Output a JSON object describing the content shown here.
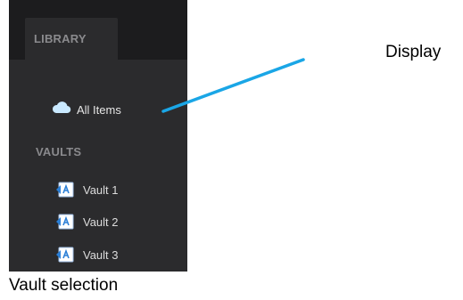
{
  "sidebar": {
    "tab_label": "LIBRARY",
    "all_items_label": "All Items",
    "all_items_icon": "cloud-icon",
    "vaults_heading": "VAULTS",
    "vault_icon": "vault-icon",
    "vaults": [
      {
        "label": "Vault 1"
      },
      {
        "label": "Vault 2"
      },
      {
        "label": "Vault 3"
      }
    ]
  },
  "annotations": {
    "display_label": "Display",
    "caption": "Vault selection",
    "pointer_color": "#1aa6e6"
  },
  "colors": {
    "sidebar_bg": "#2b2b2d",
    "sidebar_top": "#1c1c1e",
    "muted_text": "#8a8a8d",
    "item_text": "#e6e6e6",
    "vault_icon_blue": "#2b7fd6"
  }
}
